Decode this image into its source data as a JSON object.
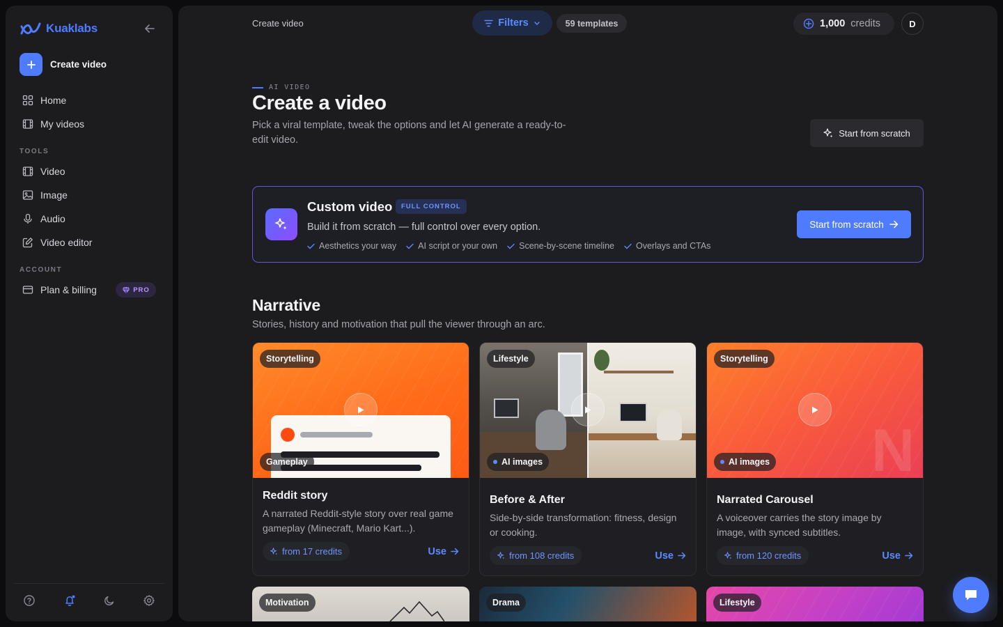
{
  "sidebar": {
    "brand": "Kuaklabs",
    "create_label": "Create video",
    "nav": [
      {
        "label": "Home",
        "icon": "grid-icon"
      },
      {
        "label": "My videos",
        "icon": "film-icon"
      }
    ],
    "tools_title": "TOOLS",
    "tools": [
      {
        "label": "Video",
        "icon": "film-icon"
      },
      {
        "label": "Image",
        "icon": "image-icon"
      },
      {
        "label": "Audio",
        "icon": "mic-icon"
      },
      {
        "label": "Video editor",
        "icon": "edit-icon"
      }
    ],
    "account_title": "ACCOUNT",
    "account": [
      {
        "label": "Plan & billing",
        "icon": "card-icon",
        "badge": "PRO"
      }
    ]
  },
  "topbar": {
    "breadcrumb": "Create video",
    "filters_label": "Filters",
    "template_count": "59 templates",
    "credits_value": "1,000",
    "credits_unit": "credits",
    "avatar_initial": "D"
  },
  "hero": {
    "eyebrow": "AI VIDEO",
    "title": "Create a video",
    "subtitle": "Pick a viral template, tweak the options and let AI generate a ready-to-edit video.",
    "scratch_button": "Start from scratch"
  },
  "custom": {
    "title": "Custom video",
    "badge": "FULL CONTROL",
    "description": "Build it from scratch — full control over every option.",
    "features": [
      "Aesthetics your way",
      "AI script or your own",
      "Scene-by-scene timeline",
      "Overlays and CTAs"
    ],
    "button": "Start from scratch"
  },
  "section": {
    "title": "Narrative",
    "subtitle": "Stories, history and motivation that pull the viewer through an arc."
  },
  "cards": [
    {
      "tag": "Storytelling",
      "bottom_tag": "Gameplay",
      "title": "Reddit story",
      "desc": "A narrated Reddit-style story over real game gameplay (Minecraft, Mario Kart...).",
      "credits": "from 17 credits",
      "use": "Use"
    },
    {
      "tag": "Lifestyle",
      "bottom_tag": "AI images",
      "title": "Before & After",
      "desc": "Side-by-side transformation: fitness, design or cooking.",
      "credits": "from 108 credits",
      "use": "Use"
    },
    {
      "tag": "Storytelling",
      "bottom_tag": "AI images",
      "title": "Narrated Carousel",
      "desc": "A voiceover carries the story image by image, with synced subtitles.",
      "credits": "from 120 credits",
      "use": "Use"
    }
  ],
  "next_cards": [
    {
      "tag": "Motivation"
    },
    {
      "tag": "Drama"
    },
    {
      "tag": "Lifestyle"
    }
  ],
  "colors": {
    "accent": "#4f7cff",
    "panel": "#1c1c1f",
    "background": "#0c0c0e",
    "pro": "#b999ff"
  }
}
